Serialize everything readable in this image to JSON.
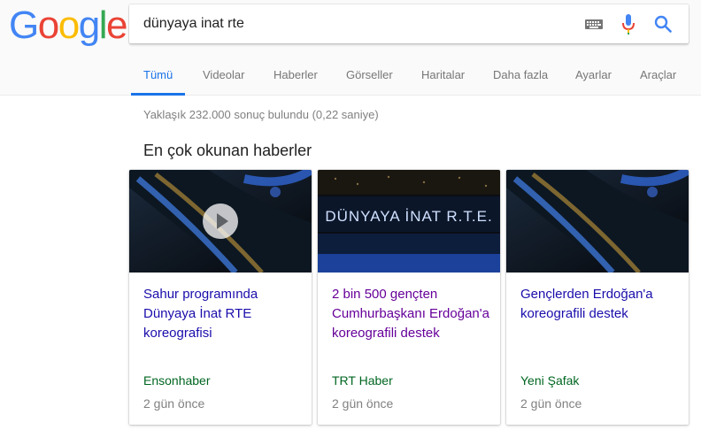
{
  "logo": {
    "text": "Google",
    "letters": [
      "G",
      "o",
      "o",
      "g",
      "l",
      "e"
    ],
    "colors": [
      "#4285f4",
      "#ea4335",
      "#fbbc05",
      "#4285f4",
      "#34a853",
      "#ea4335"
    ]
  },
  "search": {
    "query": "dünyaya inat rte",
    "icons": [
      "keyboard-icon",
      "microphone-icon",
      "search-icon"
    ]
  },
  "tabs": [
    {
      "label": "Tümü",
      "active": true
    },
    {
      "label": "Videolar"
    },
    {
      "label": "Haberler"
    },
    {
      "label": "Görseller"
    },
    {
      "label": "Haritalar"
    },
    {
      "label": "Daha fazla"
    },
    {
      "label": "Ayarlar"
    },
    {
      "label": "Araçlar"
    }
  ],
  "result_stats": "Yaklaşık 232.000 sonuç bulundu (0,22 saniye)",
  "top_stories": {
    "heading": "En çok okunan haberler",
    "cards": [
      {
        "title": "Sahur programında Dünyaya İnat RTE koreografisi",
        "source": "Ensonhaber",
        "time": "2 gün önce",
        "has_video": true,
        "visited": false
      },
      {
        "title": "2 bin 500 gençten Cumhurbaşkanı Erdoğan'a koreografili destek",
        "source": "TRT Haber",
        "time": "2 gün önce",
        "has_video": false,
        "visited": true,
        "thumb_text": "DÜNYAYA İNAT R.T.E."
      },
      {
        "title": "Gençlerden Erdoğan'a koreografili destek",
        "source": "Yeni Şafak",
        "time": "2 gün önce",
        "has_video": false,
        "visited": false
      }
    ]
  },
  "colors": {
    "link": "#1a0dab",
    "visited": "#660099",
    "source": "#006621",
    "active_tab": "#1a73e8",
    "muted": "#808080"
  }
}
